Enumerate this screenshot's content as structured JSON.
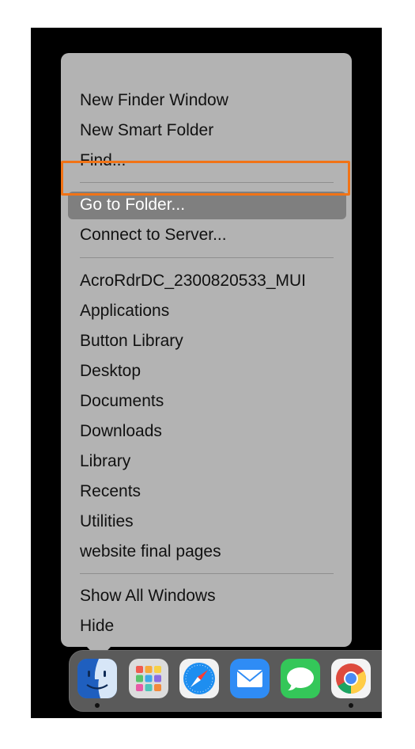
{
  "menu": {
    "items": [
      {
        "label": "New Finder Window"
      },
      {
        "label": "New Smart Folder"
      },
      {
        "label": "Find..."
      },
      {
        "label": "Go to Folder...",
        "selected": true
      },
      {
        "label": "Connect to Server..."
      },
      {
        "label": "AcroRdrDC_2300820533_MUI"
      },
      {
        "label": "Applications"
      },
      {
        "label": "Button Library"
      },
      {
        "label": "Desktop"
      },
      {
        "label": "Documents"
      },
      {
        "label": "Downloads"
      },
      {
        "label": "Library"
      },
      {
        "label": "Recents"
      },
      {
        "label": "Utilities"
      },
      {
        "label": "website final pages"
      },
      {
        "label": "Show All Windows"
      },
      {
        "label": "Hide"
      }
    ]
  },
  "highlight_color": "#f17316",
  "dock": {
    "apps": [
      {
        "icon": "finder-icon",
        "running": true
      },
      {
        "icon": "launchpad-icon",
        "running": false
      },
      {
        "icon": "safari-icon",
        "running": false
      },
      {
        "icon": "mail-icon",
        "running": false
      },
      {
        "icon": "messages-icon",
        "running": false
      },
      {
        "icon": "chrome-icon",
        "running": true
      }
    ]
  }
}
